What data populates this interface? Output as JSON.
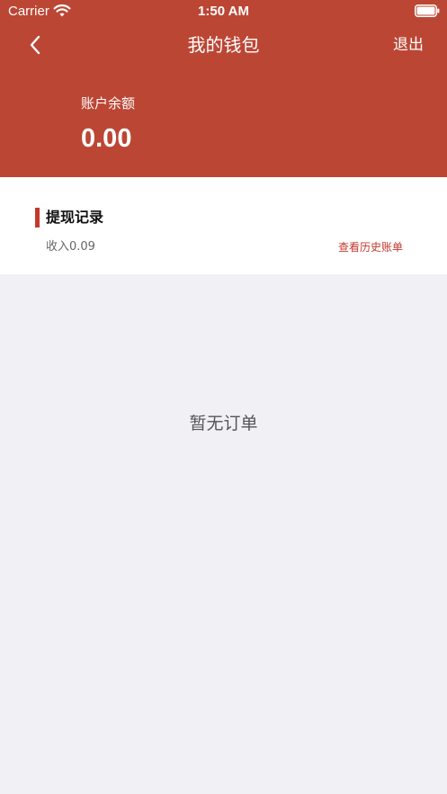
{
  "status_bar": {
    "carrier": "Carrier",
    "time": "1:50 AM",
    "wifi_icon": "wifi-icon",
    "battery_icon": "battery-icon"
  },
  "nav": {
    "back_icon": "chevron-left-icon",
    "title": "我的钱包",
    "logout_label": "退出"
  },
  "wallet": {
    "balance_label": "账户余额",
    "balance_value": "0.00"
  },
  "records": {
    "title": "提现记录",
    "income_text": "收入0.09",
    "history_link": "查看历史账单"
  },
  "empty_state": {
    "text": "暂无订单"
  },
  "colors": {
    "header_bg": "#bc4634",
    "accent": "#c2392c",
    "page_bg": "#f1f0f5"
  }
}
